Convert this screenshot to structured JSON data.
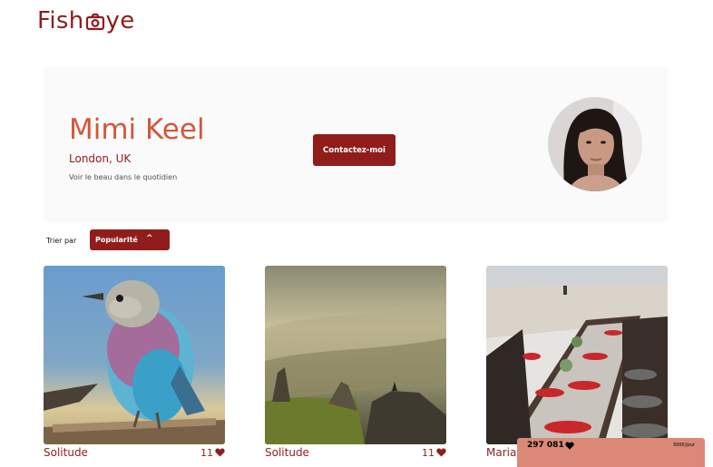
{
  "header": {
    "logo_part1": "Fish",
    "logo_part2": "ye",
    "logo_icon": "camera-icon"
  },
  "photographer": {
    "name": "Mimi Keel",
    "location": "London, UK",
    "tagline": "Voir le beau dans le quotidien",
    "contact_label": "Contactez-moi",
    "avatar_icon": "portrait-photo"
  },
  "sort": {
    "label": "Trier par",
    "selected": "Popularité",
    "chevron": "^"
  },
  "media": [
    {
      "title": "Solitude",
      "likes": "11",
      "image": "lilac-breasted-roller-bird-photo"
    },
    {
      "title": "Solitude",
      "likes": "11",
      "image": "misty-mountain-landscape-photo"
    },
    {
      "title": "Mariag",
      "likes": "",
      "image": "wedding-banquet-table-photo"
    }
  ],
  "stats": {
    "total_likes": "297 081",
    "price": "300€/jour"
  },
  "colors": {
    "primary": "#901C1C",
    "accent": "#D3573C",
    "stats_bg": "#DB8876",
    "panel_bg": "#FAFAFA"
  }
}
